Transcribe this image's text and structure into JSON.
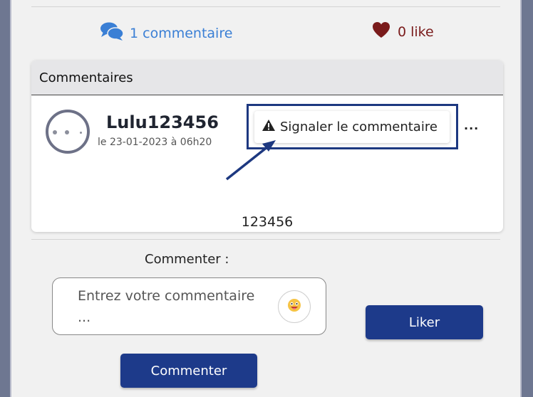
{
  "stats": {
    "comments_label": "1 commentaire",
    "likes_label": "0 like"
  },
  "comments_section": {
    "header": "Commentaires",
    "comment": {
      "username": "Lulu123456",
      "date": "le 23-01-2023 à 06h20",
      "report_label": "Signaler le commentaire",
      "more_label": "...",
      "text": "123456"
    }
  },
  "form": {
    "label": "Commenter :",
    "placeholder": "Entrez votre commentaire ...",
    "submit_label": "Commenter",
    "like_label": "Liker"
  },
  "colors": {
    "accent_blue": "#3a7fd5",
    "like_red": "#7a1b1b",
    "navy_button": "#1d3a8a",
    "highlight_border": "#1d3880"
  },
  "icons": [
    "comments-icon",
    "heart-icon",
    "warning-icon",
    "emoji-icon",
    "avatar-placeholder"
  ]
}
